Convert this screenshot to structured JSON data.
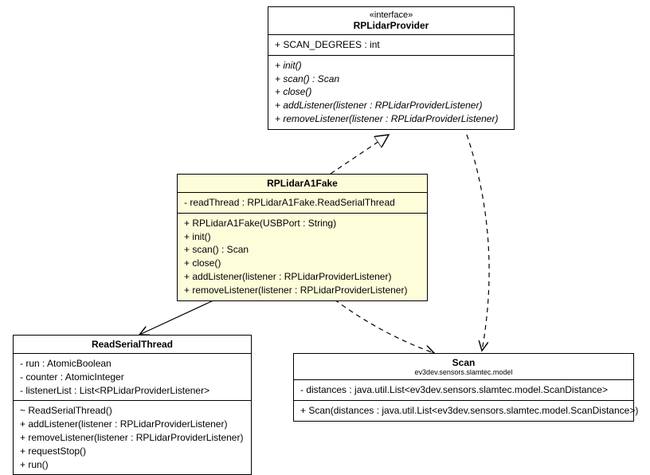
{
  "interface": {
    "stereotype": "«interface»",
    "name": "RPLidarProvider",
    "attrs": [
      "+ SCAN_DEGREES : int"
    ],
    "ops": [
      "+ init()",
      "+ scan() : Scan",
      "+ close()",
      "+ addListener(listener : RPLidarProviderListener)",
      "+ removeListener(listener : RPLidarProviderListener)"
    ]
  },
  "fake": {
    "name": "RPLidarA1Fake",
    "attrs": [
      "- readThread : RPLidarA1Fake.ReadSerialThread"
    ],
    "ops": [
      "+ RPLidarA1Fake(USBPort : String)",
      "+ init()",
      "+ scan() : Scan",
      "+ close()",
      "+ addListener(listener : RPLidarProviderListener)",
      "+ removeListener(listener : RPLidarProviderListener)"
    ]
  },
  "readThread": {
    "name": "ReadSerialThread",
    "attrs": [
      "- run : AtomicBoolean",
      "- counter : AtomicInteger",
      "- listenerList : List<RPLidarProviderListener>"
    ],
    "ops": [
      "~ ReadSerialThread()",
      "+ addListener(listener : RPLidarProviderListener)",
      "+ removeListener(listener : RPLidarProviderListener)",
      "+ requestStop()",
      "+ run()"
    ]
  },
  "scan": {
    "name": "Scan",
    "ns": "ev3dev.sensors.slamtec.model",
    "attrs": [
      "- distances : java.util.List<ev3dev.sensors.slamtec.model.ScanDistance>"
    ],
    "ops": [
      "+ Scan(distances : java.util.List<ev3dev.sensors.slamtec.model.ScanDistance>)"
    ]
  }
}
